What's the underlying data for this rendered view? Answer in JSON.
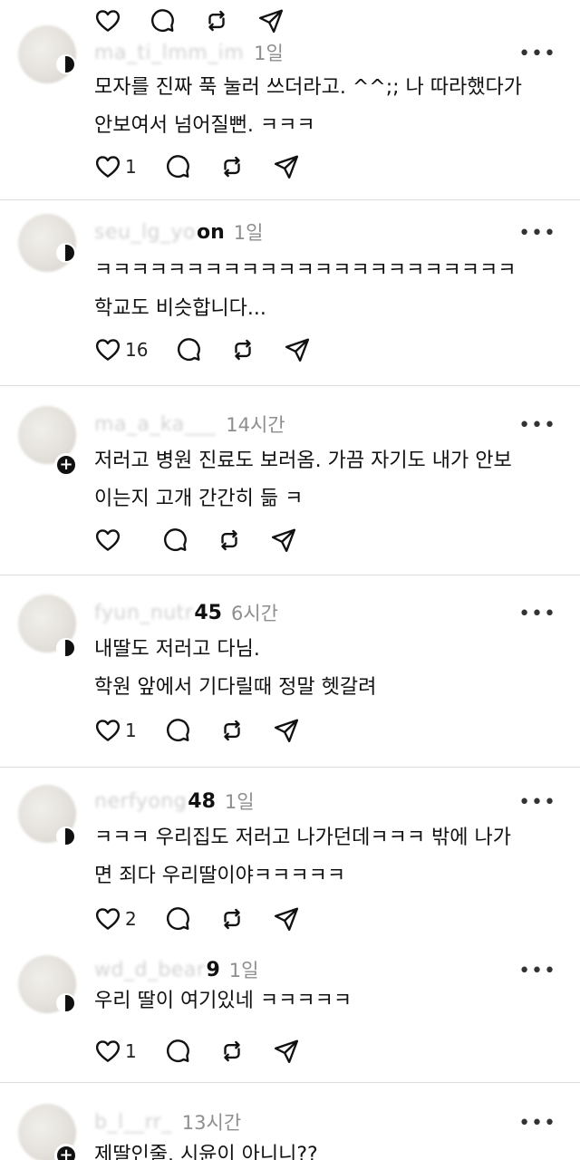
{
  "posts": [
    {
      "username_blur": "ma_ti_lmm_im",
      "username_suffix": "",
      "time": "1일",
      "text": "모자를 진짜 푹 눌러 쓰더라고. ^^;; 나 따라했다가\n안보여서 넘어질뻔. ㅋㅋㅋ",
      "likes": "1"
    },
    {
      "username_blur": "seu_lg_yo",
      "username_suffix": "on",
      "time": "1일",
      "text": "ㅋㅋㅋㅋㅋㅋㅋㅋㅋㅋㅋㅋㅋㅋㅋㅋㅋㅋㅋㅋㅋㅋㅋ\n학교도 비슷합니다...",
      "likes": "16"
    },
    {
      "username_blur": "ma_a_ka___",
      "username_suffix": "",
      "time": "14시간",
      "text": "저러고 병원 진료도 보러옴. 가끔 자기도 내가 안보\n이는지 고개 간간히 듦 ㅋ",
      "likes": ""
    },
    {
      "username_blur": "fyun_nutr",
      "username_suffix": "45",
      "time": "6시간",
      "text": "내딸도 저러고 다님.\n학원 앞에서 기다릴때 정말 헷갈려",
      "likes": "1"
    },
    {
      "username_blur": "nerfyong",
      "username_suffix": "48",
      "time": "1일",
      "text": "ㅋㅋㅋ 우리집도 저러고 나가던데ㅋㅋㅋ 밖에 나가\n면 죄다 우리딸이야ㅋㅋㅋㅋㅋ",
      "likes": "2"
    },
    {
      "username_blur": "wd_d_bear",
      "username_suffix": "9",
      "time": "1일",
      "text": "우리 딸이 여기있네 ㅋㅋㅋㅋㅋ",
      "likes": "1"
    },
    {
      "username_blur": "b_l__rr_",
      "username_suffix": "",
      "time": "13시간",
      "text": "제딸인줄. 시윤이 아니니??",
      "likes": ""
    }
  ],
  "icons": {
    "like": "heart-icon",
    "reply": "comment-icon",
    "repost": "repost-icon",
    "share": "send-icon",
    "more": "more-icon"
  },
  "more_label": "•••"
}
